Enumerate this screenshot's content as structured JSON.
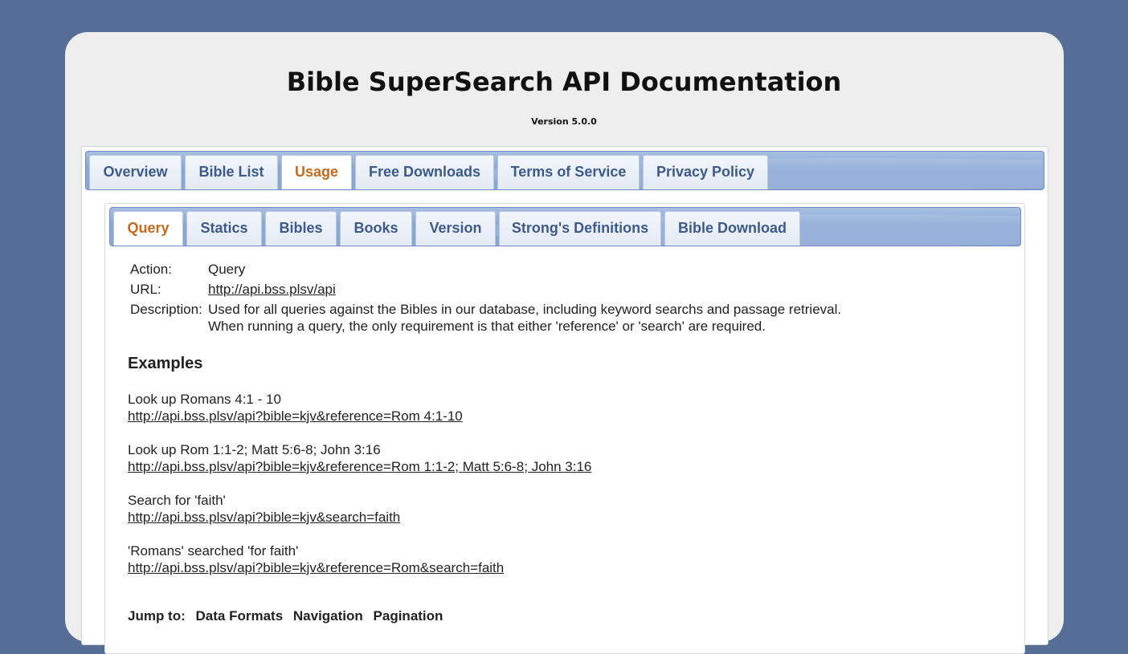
{
  "header": {
    "title": "Bible SuperSearch API Documentation",
    "version": "Version 5.0.0"
  },
  "main_tabs": [
    {
      "label": "Overview",
      "active": false
    },
    {
      "label": "Bible List",
      "active": false
    },
    {
      "label": "Usage",
      "active": true
    },
    {
      "label": "Free Downloads",
      "active": false
    },
    {
      "label": "Terms of Service",
      "active": false
    },
    {
      "label": "Privacy Policy",
      "active": false
    }
  ],
  "sub_tabs": [
    {
      "label": "Query",
      "active": true
    },
    {
      "label": "Statics",
      "active": false
    },
    {
      "label": "Bibles",
      "active": false
    },
    {
      "label": "Books",
      "active": false
    },
    {
      "label": "Version",
      "active": false
    },
    {
      "label": "Strong's Definitions",
      "active": false
    },
    {
      "label": "Bible Download",
      "active": false
    }
  ],
  "info": {
    "action_label": "Action:",
    "action_value": "Query",
    "url_label": "URL:",
    "url_value": "http://api.bss.plsv/api",
    "description_label": "Description:",
    "description_line1": "Used for all queries against the Bibles in our database, including keyword searchs and passage retrieval.",
    "description_line2": "When running a query, the only requirement is that either 'reference' or 'search' are required."
  },
  "examples": {
    "heading": "Examples",
    "items": [
      {
        "title": "Look up Romans 4:1 - 10",
        "url": "http://api.bss.plsv/api?bible=kjv&reference=Rom 4:1-10"
      },
      {
        "title": "Look up Rom 1:1-2; Matt 5:6-8; John 3:16",
        "url": "http://api.bss.plsv/api?bible=kjv&reference=Rom 1:1-2; Matt 5:6-8; John 3:16"
      },
      {
        "title": "Search for 'faith'",
        "url": "http://api.bss.plsv/api?bible=kjv&search=faith"
      },
      {
        "title": "'Romans' searched 'for faith'",
        "url": "http://api.bss.plsv/api?bible=kjv&reference=Rom&search=faith"
      }
    ]
  },
  "jump": {
    "label": "Jump to:",
    "links": [
      "Data Formats",
      "Navigation",
      "Pagination"
    ]
  },
  "colors": {
    "background": "#566e96",
    "card": "#eeeeee",
    "tab_text": "#3d5a8a",
    "active_tab_text": "#c66a1e",
    "tab_bar": "#8aa8d6"
  }
}
